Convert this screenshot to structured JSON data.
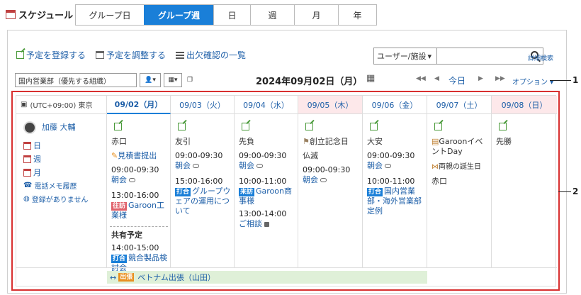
{
  "app": {
    "title": "スケジュール"
  },
  "view_tabs": [
    {
      "label": "グループ日",
      "active": false
    },
    {
      "label": "グループ週",
      "active": true
    },
    {
      "label": "日",
      "active": false
    },
    {
      "label": "週",
      "active": false
    },
    {
      "label": "月",
      "active": false
    },
    {
      "label": "年",
      "active": false
    }
  ],
  "actions": {
    "register": "予定を登録する",
    "adjust": "予定を調整する",
    "attendance": "出欠確認の一覧"
  },
  "search": {
    "category": "ユーザー/施設",
    "value": "",
    "detail": "詳細検索"
  },
  "group": {
    "selected": "国内営業部（優先する組織）"
  },
  "date_title": "2024年09月02日（月）",
  "nav": {
    "prev_week": "◀◀",
    "prev_day": "◀",
    "today": "今日",
    "next_day": "▶",
    "next_week": "▶▶",
    "option": "オプション ▾"
  },
  "grid": {
    "timezone": "(UTC+09:00) 東京",
    "days": [
      {
        "label": "09/02（月）",
        "type": "today"
      },
      {
        "label": "09/03（火）",
        "type": "normal"
      },
      {
        "label": "09/04（水）",
        "type": "normal"
      },
      {
        "label": "09/05（木）",
        "type": "holiday"
      },
      {
        "label": "09/06（金）",
        "type": "normal"
      },
      {
        "label": "09/07（土）",
        "type": "normal"
      },
      {
        "label": "09/08（日）",
        "type": "holiday"
      }
    ],
    "user": {
      "name": "加藤 大輔",
      "menu": [
        "日",
        "週",
        "月",
        "電話メモ履歴",
        "登録がありません"
      ]
    },
    "d0": {
      "rokuyo": "赤口",
      "mitsumori": "見積書提出",
      "ev1_time": "09:00-09:30",
      "ev1_title": "朝会",
      "ev2_time": "13:00-16:00",
      "ev2_tag": "往訪",
      "ev2_title": "Garoon工業様",
      "shared": "共有予定",
      "ev3_time": "14:00-15:00",
      "ev3_tag": "打合",
      "ev3_title": "競合製品検討会"
    },
    "d1": {
      "rokuyo": "友引",
      "ev1_time": "09:00-09:30",
      "ev1_title": "朝会",
      "ev2_time": "15:00-16:00",
      "ev2_tag": "打合",
      "ev2_title": "グループウェアの運用について"
    },
    "d2": {
      "rokuyo": "先負",
      "ev1_time": "09:00-09:30",
      "ev1_title": "朝会",
      "ev2_time": "10:00-11:00",
      "ev2_tag": "来訪",
      "ev2_title": "Garoon商事様",
      "ev3_time": "13:00-14:00",
      "ev3_title": "ご相談"
    },
    "d3": {
      "holiday": "創立記念日",
      "rokuyo": "仏滅",
      "ev1_time": "09:00-09:30",
      "ev1_title": "朝会"
    },
    "d4": {
      "rokuyo": "大安",
      "ev1_time": "09:00-09:30",
      "ev1_title": "朝会",
      "ev2_time": "10:00-11:00",
      "ev2_tag": "打合",
      "ev2_title": "国内営業部・海外営業部定例"
    },
    "d5": {
      "event": "GaroonイベントDay",
      "birthday": "両親の誕生日",
      "rokuyo": "赤口"
    },
    "d6": {
      "rokuyo": "先勝"
    },
    "banner": {
      "tag": "出張",
      "title": "ベトナム出張（山田）"
    }
  },
  "callouts": {
    "one": "1",
    "two": "2"
  }
}
